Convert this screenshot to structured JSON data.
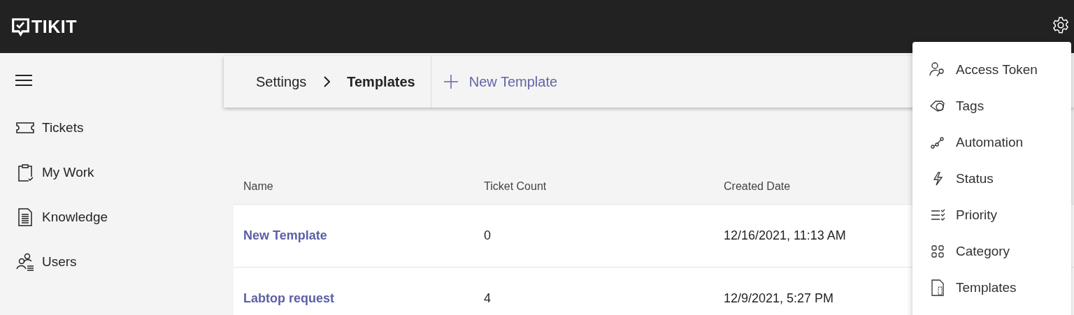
{
  "header": {
    "brand": "TIKIT"
  },
  "sidebar": {
    "items": [
      {
        "label": "Tickets"
      },
      {
        "label": "My Work"
      },
      {
        "label": "Knowledge"
      },
      {
        "label": "Users"
      }
    ]
  },
  "toolbar": {
    "breadcrumb": [
      "Settings",
      "Templates"
    ],
    "new_button": "New Template"
  },
  "table": {
    "columns": [
      "Name",
      "Ticket Count",
      "Created Date"
    ],
    "rows": [
      [
        "New Template",
        "0",
        "12/16/2021, 11:13 AM"
      ],
      [
        "Labtop request",
        "4",
        "12/9/2021, 5:27 PM"
      ]
    ]
  },
  "settings_menu": {
    "items": [
      "Access Token",
      "Tags",
      "Automation",
      "Status",
      "Priority",
      "Category",
      "Templates"
    ]
  }
}
